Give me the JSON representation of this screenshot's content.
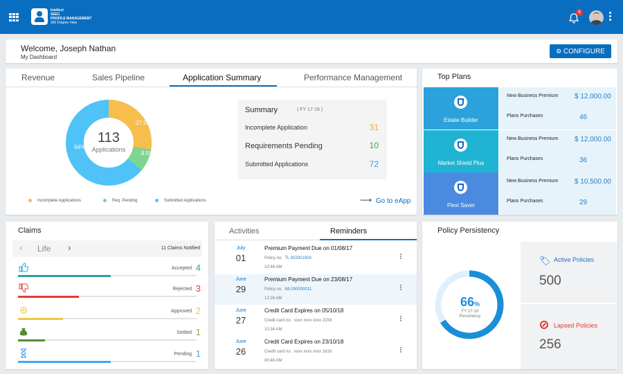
{
  "header": {
    "brand_line1": "Intellect",
    "brand_line2": "SEEC",
    "brand_line3": "PROFILE MANAGEMENT",
    "brand_line4": "360 Degree View",
    "notif_count": "6",
    "accent": "#0a6ec0"
  },
  "welcome": {
    "title": "Welcome, Joseph Nathan",
    "subtitle": "My Dashboard",
    "configure": "CONFIGURE"
  },
  "app_tabs": [
    "Revenue",
    "Sales Pipeline",
    "Application Summary",
    "Performance Management"
  ],
  "donut": {
    "total": "113",
    "total_label": "Applications",
    "seg1": "27.5%",
    "seg2": "8.5%",
    "seg3": "64%",
    "legend": [
      "Incomplete Applications",
      "Req. Pending",
      "Submitted Applications"
    ],
    "colors": [
      "#f8be4c",
      "#7fd58f",
      "#4fc3f7"
    ]
  },
  "summary": {
    "title": "Summary",
    "fy": "( FY 17-18 )",
    "rows": [
      {
        "label": "Incomplete Application",
        "value": "31"
      },
      {
        "label": "Requirements Pending",
        "value": "10"
      },
      {
        "label": "Submitted Applications",
        "value": "72"
      }
    ],
    "go": "Go to eApp"
  },
  "top_plans": {
    "title": "Top Plans",
    "nb_label": "New Business Premium",
    "pp_label": "Plans Purchases",
    "plans": [
      {
        "name": "Estate Builder",
        "premium": "$ 12,000.00",
        "purchases": "46"
      },
      {
        "name": "Market Shield Plus",
        "premium": "$ 12,000.00",
        "purchases": "36"
      },
      {
        "name": "Flexi Saver",
        "premium": "$ 10,500.00",
        "purchases": "29"
      }
    ]
  },
  "claims": {
    "title": "Claims",
    "product": "Life",
    "notified": "11 Claims Notified",
    "rows": [
      {
        "label": "Accepted",
        "value": "4",
        "level": 0.52,
        "color": "#26a69a"
      },
      {
        "label": "Rejected",
        "value": "3",
        "level": 0.34,
        "color": "#e53935"
      },
      {
        "label": "Approved",
        "value": "2",
        "level": 0.25,
        "color": "#f4c542"
      },
      {
        "label": "Settled",
        "value": "1",
        "level": 0.15,
        "color": "#558b2f"
      },
      {
        "label": "Pending",
        "value": "1",
        "level": 0.52,
        "color": "#42a5f5"
      }
    ]
  },
  "reminders": {
    "tab1": "Activities",
    "tab2": "Reminders",
    "items": [
      {
        "month": "July",
        "day": "01",
        "title": "Premium Payment Due on 01/08/17",
        "label": "Policy no.",
        "ref": "TL 602001926",
        "time": "10:48 AM"
      },
      {
        "month": "June",
        "day": "29",
        "title": "Premium Payment Due on 23/08/17",
        "label": "Policy no.",
        "ref": "WL000000011",
        "time": "12:26 AM"
      },
      {
        "month": "June",
        "day": "27",
        "title": "Credit Card Expires on 05/10/18",
        "label": "Credit card no.",
        "ref": "xxxx xxxx xxxx 2158",
        "time": "10:34 AM"
      },
      {
        "month": "June",
        "day": "26",
        "title": "Credit Card Expires on 23/10/18",
        "label": "Credit card no.",
        "ref": "xxxx xxxx xxxx 1616",
        "time": "00:48 AM"
      }
    ]
  },
  "persistency": {
    "title": "Policy Persistency",
    "percent": "66",
    "percent_sign": "%",
    "fy": "FY 17-18",
    "label": "Persistency",
    "level": 0.66,
    "active_label": "Active Policies",
    "active": "500",
    "lapsed_label": "Lapsed Policies",
    "lapsed": "256"
  }
}
